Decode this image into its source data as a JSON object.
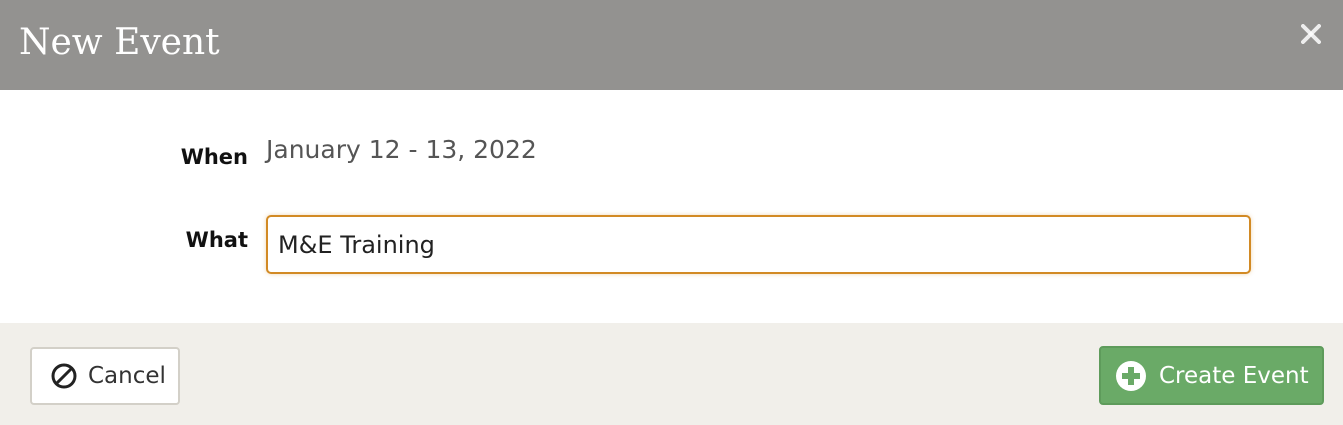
{
  "dialog": {
    "title": "New Event",
    "close_icon": "close-icon"
  },
  "form": {
    "when_label": "When",
    "when_value": "January 12 - 13, 2022",
    "what_label": "What",
    "what_value": "M&E Training"
  },
  "footer": {
    "cancel_label": "Cancel",
    "cancel_icon": "ban-icon",
    "create_label": "Create Event",
    "create_icon": "plus-circle-icon"
  },
  "colors": {
    "header_bg": "#939290",
    "footer_bg": "#f1efea",
    "input_border": "#d28a24",
    "create_button_bg": "#6aaa67"
  }
}
